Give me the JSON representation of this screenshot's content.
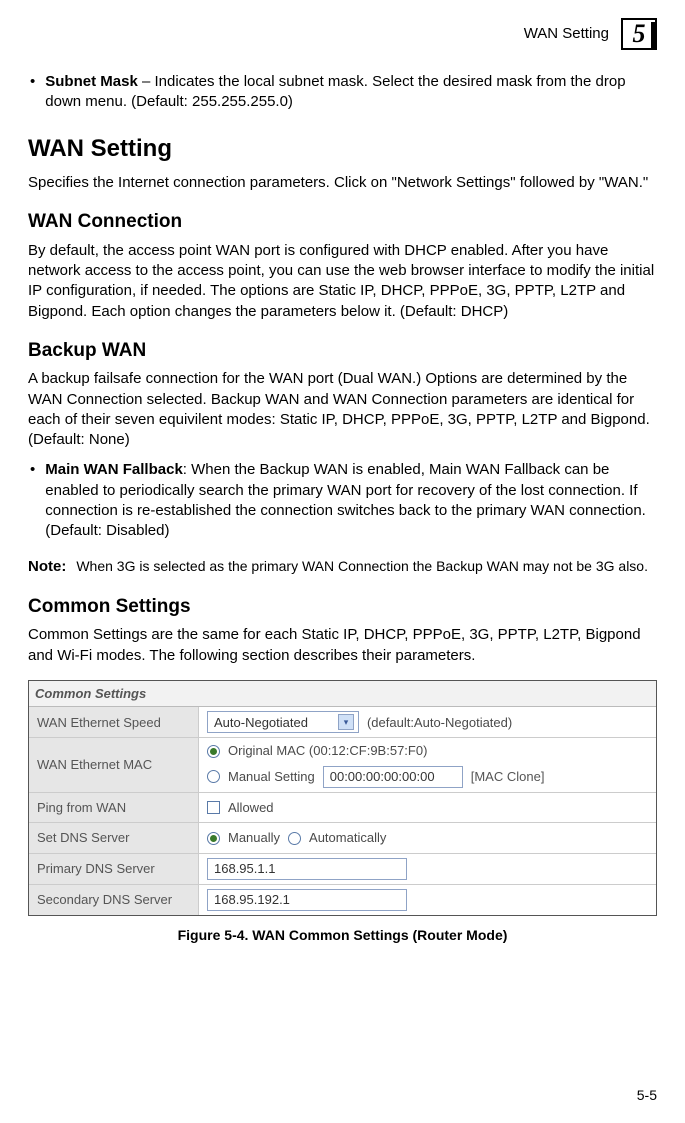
{
  "header": {
    "title": "WAN Setting",
    "chapter": "5"
  },
  "subnet_mask": {
    "term": "Subnet Mask",
    "desc": " – Indicates the local subnet mask. Select the desired mask from the drop down menu. (Default: 255.255.255.0)"
  },
  "wan_setting": {
    "title": "WAN Setting",
    "intro": "Specifies the Internet connection parameters. Click on \"Network Settings\" followed by \"WAN.\""
  },
  "wan_connection": {
    "title": "WAN Connection",
    "body": "By default, the access point WAN port is configured with DHCP enabled. After you have network access to the access point, you can use the web browser interface to modify the initial IP configuration, if needed. The options are Static IP, DHCP, PPPoE, 3G, PPTP, L2TP and Bigpond. Each option changes the parameters below it. (Default: DHCP)"
  },
  "backup_wan": {
    "title": "Backup WAN",
    "body": "A backup failsafe connection for the WAN port (Dual WAN.) Options are determined by the WAN Connection selected. Backup WAN and WAN Connection parameters are identical for each of their seven equivilent modes: Static IP, DHCP, PPPoE, 3G, PPTP, L2TP and Bigpond. (Default: None)",
    "fallback_term": "Main WAN Fallback",
    "fallback_desc": ": When the Backup WAN is enabled, Main WAN Fallback can be enabled to periodically search the primary WAN port for recovery of the lost connection. If connection is re-established the connection switches back to the primary WAN connection. (Default: Disabled)"
  },
  "note": {
    "label": "Note:",
    "body": "When 3G is selected as the primary WAN Connection the Backup WAN may not be 3G also."
  },
  "common_settings": {
    "title": "Common Settings",
    "body": "Common Settings are the same for each Static IP, DHCP, PPPoE, 3G, PPTP, L2TP, Bigpond and Wi-Fi modes. The following section describes their parameters."
  },
  "settings_panel": {
    "title": "Common Settings",
    "eth_speed": {
      "label": "WAN Ethernet Speed",
      "value": "Auto-Negotiated",
      "hint": "(default:Auto-Negotiated)"
    },
    "eth_mac": {
      "label": "WAN Ethernet MAC",
      "original_label": "Original MAC (00:12:CF:9B:57:F0)",
      "manual_label": "Manual Setting",
      "manual_value": "00:00:00:00:00:00",
      "clone": "[MAC Clone]"
    },
    "ping": {
      "label": "Ping from WAN",
      "option": "Allowed"
    },
    "dns_mode": {
      "label": "Set DNS Server",
      "manual": "Manually",
      "auto": "Automatically"
    },
    "primary_dns": {
      "label": "Primary DNS Server",
      "value": "168.95.1.1"
    },
    "secondary_dns": {
      "label": "Secondary DNS Server",
      "value": "168.95.192.1"
    }
  },
  "figure_caption": "Figure 5-4.   WAN Common Settings (Router Mode)",
  "page_number": "5-5"
}
